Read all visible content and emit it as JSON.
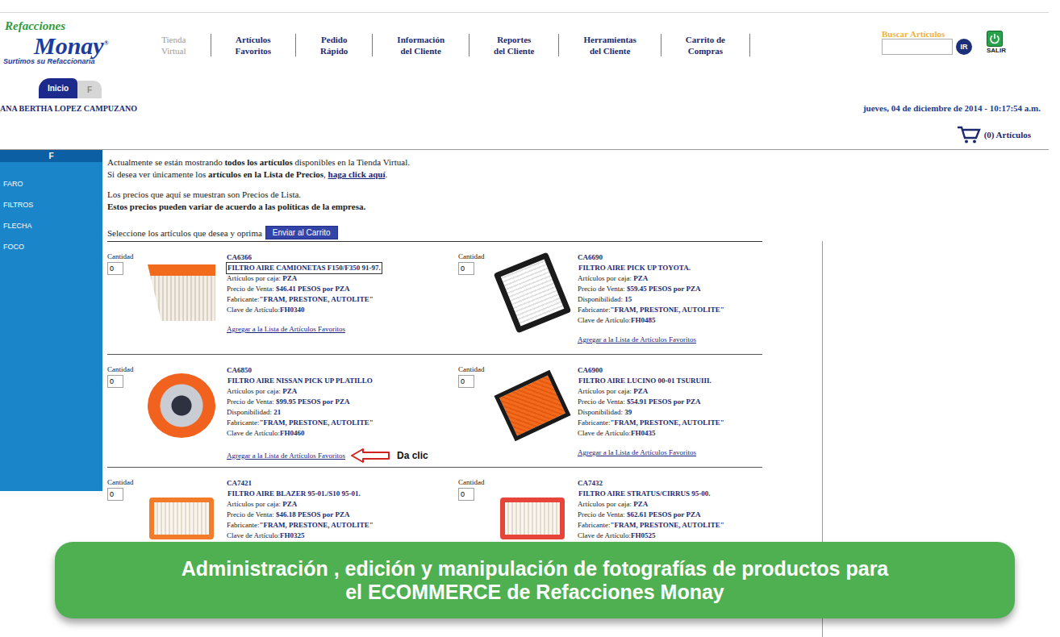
{
  "logo": {
    "brand_top": "Refacciones",
    "brand_main": "Monay",
    "mark": "®",
    "tagline": "Surtimos su Refaccionaria"
  },
  "nav": [
    {
      "lines": [
        "Tienda",
        "Virtual"
      ],
      "selected": true
    },
    {
      "lines": [
        "Artículos",
        "Favoritos"
      ],
      "selected": false
    },
    {
      "lines": [
        "Pedido",
        "Rápido"
      ],
      "selected": false
    },
    {
      "lines": [
        "Información",
        "del Cliente"
      ],
      "selected": false
    },
    {
      "lines": [
        "Reportes",
        "del Cliente"
      ],
      "selected": false
    },
    {
      "lines": [
        "Herramientas",
        "del Cliente"
      ],
      "selected": false
    },
    {
      "lines": [
        "Carrito de",
        "Compras"
      ],
      "selected": false
    }
  ],
  "search": {
    "label": "Buscar Artículos",
    "value": "",
    "button": "IR"
  },
  "exit": {
    "label": "SALIR"
  },
  "tabs": [
    {
      "label": "Inicio",
      "selected": true
    },
    {
      "label": "F",
      "selected": false
    }
  ],
  "user": "ANA BERTHA LOPEZ CAMPUZANO",
  "datetime": "jueves, 04 de diciembre de 2014 - 10:17:54 a.m.",
  "cart": {
    "count": "(0) Artículos"
  },
  "sidebar": {
    "header": "F",
    "items": [
      "FARO",
      "FILTROS",
      "FLECHA",
      "FOCO"
    ]
  },
  "notice": [
    [
      {
        "text": "Actualmente se están mostrando ",
        "kind": "plain"
      },
      {
        "text": "todos los artículos",
        "kind": "bold"
      },
      {
        "text": " disponibles en la Tienda Virtual.",
        "kind": "plain"
      }
    ],
    [
      {
        "text": "Si desea ver únicamente los ",
        "kind": "plain"
      },
      {
        "text": "artículos en la Lista de Precios",
        "kind": "bold"
      },
      {
        "text": ", ",
        "kind": "plain"
      },
      {
        "text": "haga click aquí",
        "kind": "link"
      },
      {
        "text": ".",
        "kind": "plain"
      }
    ],
    [
      {
        "text": "Los precios que aquí se muestran son Precios de Lista.",
        "kind": "plain"
      }
    ],
    [
      {
        "text": "Estos precios pueden variar de acuerdo a las políticas de la empresa.",
        "kind": "bold"
      }
    ]
  ],
  "select_prompt": {
    "text": "Seleccione los artículos que desea y oprima",
    "button": "Enviar al Carrito"
  },
  "annotation": "Da clic",
  "products": [
    {
      "qty_label": "Cantidad",
      "qty": "0",
      "code": "CA6366",
      "name": "FILTRO AIRE CAMIONETAS F150/F350 91-97.",
      "outlined": true,
      "kind": "orange-wedge",
      "annotated": false,
      "details": [
        {
          "label": "Artículos por caja: ",
          "value": "PZA"
        },
        {
          "label": "Precio de Venta: ",
          "value": "$46.41 PESOS por PZA"
        },
        {
          "label": "Fabricante:",
          "value": "\"FRAM, PRESTONE, AUTOLITE\""
        },
        {
          "label": "Clave de Artículo:",
          "value": "FH0340"
        }
      ],
      "link": "Agregar a la Lista de Artículos Favoritos"
    },
    {
      "qty_label": "Cantidad",
      "qty": "0",
      "code": "CA6690",
      "name": "FILTRO AIRE PICK UP TOYOTA.",
      "outlined": false,
      "kind": "black-panel",
      "annotated": false,
      "details": [
        {
          "label": "Artículos por caja: ",
          "value": "PZA"
        },
        {
          "label": "Precio de Venta: ",
          "value": "$59.45 PESOS por PZA"
        },
        {
          "label": "Disponibilidad: ",
          "value": "15"
        },
        {
          "label": "Fabricante:",
          "value": "\"FRAM, PRESTONE, AUTOLITE\""
        },
        {
          "label": "Clave de Artículo:",
          "value": "FH0485"
        }
      ],
      "link": "Agregar a la Lista de Artículos Favoritos"
    },
    {
      "qty_label": "Cantidad",
      "qty": "0",
      "code": "CA6850",
      "name": "FILTRO AIRE NISSAN PICK UP PLATILLO",
      "outlined": false,
      "kind": "round",
      "annotated": true,
      "details": [
        {
          "label": "Artículos por caja: ",
          "value": "PZA"
        },
        {
          "label": "Precio de Venta: ",
          "value": "$99.95 PESOS por PZA"
        },
        {
          "label": "Disponibilidad: ",
          "value": "21"
        },
        {
          "label": "Fabricante:",
          "value": "\"FRAM, PRESTONE, AUTOLITE\""
        },
        {
          "label": "Clave de Artículo:",
          "value": "FH0460"
        }
      ],
      "link": "Agregar a la Lista de Artículos Favoritos"
    },
    {
      "qty_label": "Cantidad",
      "qty": "0",
      "code": "CA6900",
      "name": "FILTRO AIRE LUCINO 00-01 TSURUIII.",
      "outlined": false,
      "kind": "orange-panel",
      "annotated": false,
      "details": [
        {
          "label": "Artículos por caja: ",
          "value": "PZA"
        },
        {
          "label": "Precio de Venta: ",
          "value": "$54.91 PESOS por PZA"
        },
        {
          "label": "Disponibilidad: ",
          "value": "39"
        },
        {
          "label": "Fabricante:",
          "value": "\"FRAM, PRESTONE, AUTOLITE\""
        },
        {
          "label": "Clave de Artículo:",
          "value": "FH0435"
        }
      ],
      "link": "Agregar a la Lista de Artículos Favoritos"
    },
    {
      "qty_label": "Cantidad",
      "qty": "0",
      "code": "CA7421",
      "name": "FILTRO AIRE BLAZER 95-01./S10 95-01.",
      "outlined": false,
      "kind": "orange-tray",
      "annotated": false,
      "details": [
        {
          "label": "Artículos por caja: ",
          "value": "PZA"
        },
        {
          "label": "Precio de Venta: ",
          "value": "$46.18 PESOS por PZA"
        },
        {
          "label": "Fabricante:",
          "value": "\"FRAM, PRESTONE, AUTOLITE\""
        },
        {
          "label": "Clave de Artículo:",
          "value": "FH0325"
        }
      ],
      "link": ""
    },
    {
      "qty_label": "Cantidad",
      "qty": "0",
      "code": "CA7432",
      "name": "FILTRO AIRE STRATUS/CIRRUS 95-00.",
      "outlined": false,
      "kind": "red-tray",
      "annotated": false,
      "details": [
        {
          "label": "Artículos por caja: ",
          "value": "PZA"
        },
        {
          "label": "Precio de Venta: ",
          "value": "$62.61 PESOS por PZA"
        },
        {
          "label": "Fabricante:",
          "value": "\"FRAM, PRESTONE, AUTOLITE\""
        },
        {
          "label": "Clave de Artículo:",
          "value": "FH0525"
        }
      ],
      "link": ""
    }
  ],
  "banner": {
    "lines": [
      "Administración , edición y manipulación de fotografías de productos para",
      "el ECOMMERCE de Refacciones Monay"
    ]
  }
}
